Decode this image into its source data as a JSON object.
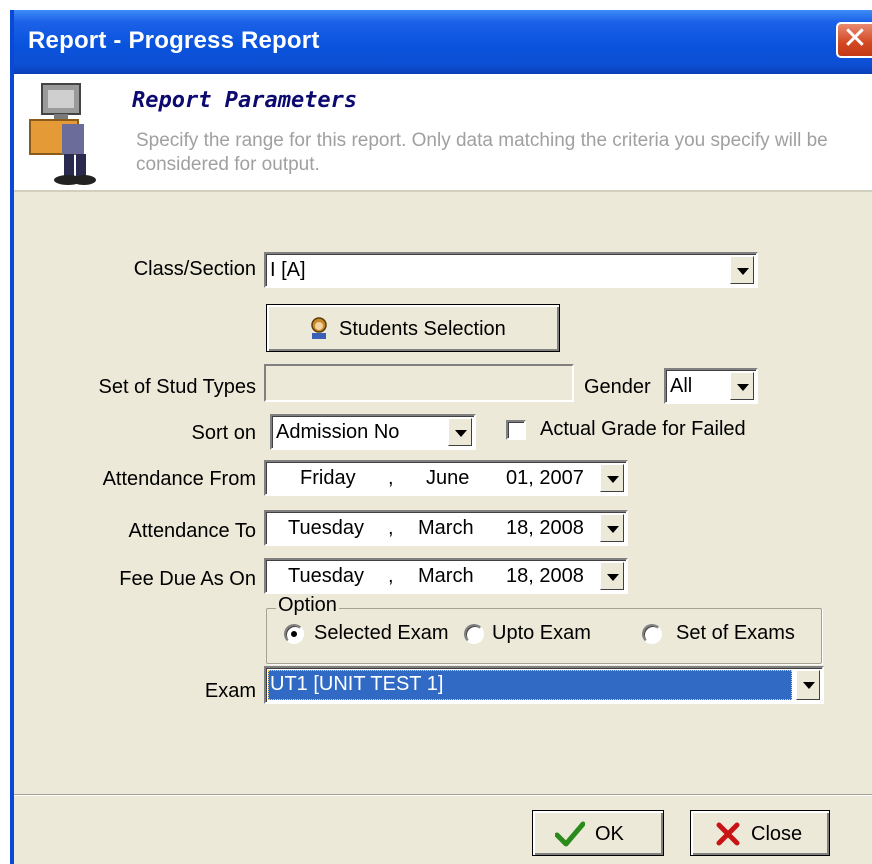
{
  "window": {
    "title": "Report - Progress Report"
  },
  "banner": {
    "heading": "Report Parameters",
    "description": "Specify the range for this report. Only data matching the criteria you specify will be considered for output."
  },
  "form": {
    "class_section": {
      "label": "Class/Section",
      "value": "I [A]"
    },
    "students_selection_label": "Students Selection",
    "stud_types": {
      "label": "Set of Stud Types",
      "value": ""
    },
    "gender": {
      "label": "Gender",
      "value": "All"
    },
    "sort_on": {
      "label": "Sort on",
      "value": "Admission No"
    },
    "actual_grade": {
      "label": "Actual Grade for Failed",
      "checked": false
    },
    "attendance_from": {
      "label": "Attendance From",
      "day": "Friday",
      "month": "June",
      "date": "01, 2007"
    },
    "attendance_to": {
      "label": "Attendance To",
      "day": "Tuesday",
      "month": "March",
      "date": "18, 2008"
    },
    "fee_due": {
      "label": "Fee Due As On",
      "day": "Tuesday",
      "month": "March",
      "date": "18, 2008"
    },
    "date_separator": ",",
    "option": {
      "title": "Option",
      "items": [
        {
          "label": "Selected Exam",
          "checked": true
        },
        {
          "label": "Upto Exam",
          "checked": false
        },
        {
          "label": "Set of Exams",
          "checked": false
        }
      ]
    },
    "exam": {
      "label": "Exam",
      "value": "UT1 [UNIT TEST 1]"
    }
  },
  "footer": {
    "ok_label": "OK",
    "close_label": "Close"
  },
  "icons": {
    "mascot": "reading-person-icon",
    "students": "student-icon",
    "ok": "checkmark-icon",
    "close": "red-x-icon"
  },
  "colors": {
    "titlebar": "#0a53dd",
    "heading": "#0c0a70",
    "selection": "#316ac5"
  }
}
